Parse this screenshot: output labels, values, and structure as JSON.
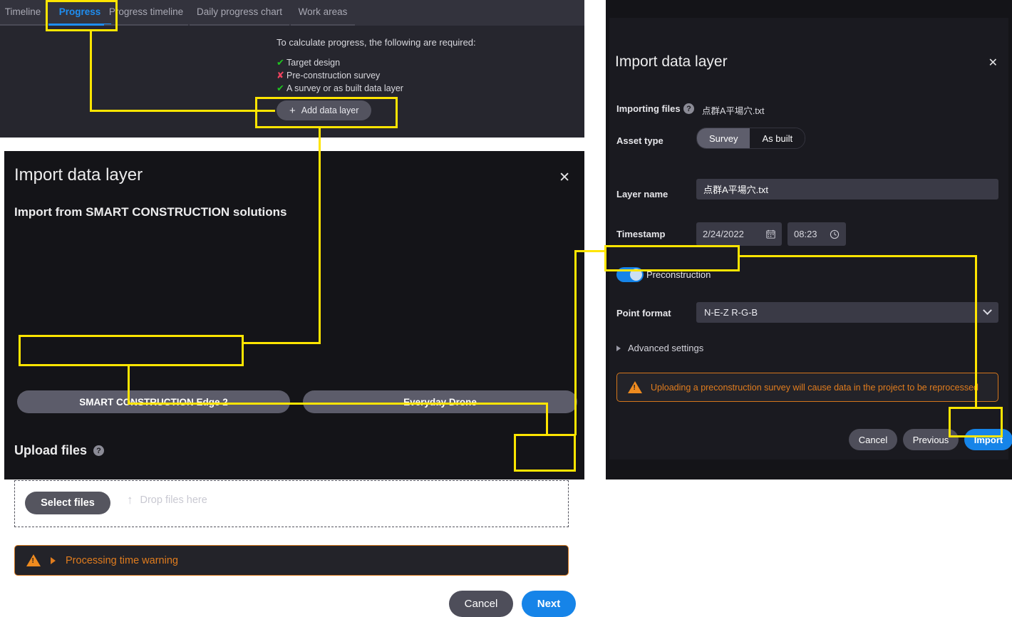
{
  "top_panel": {
    "tabs": [
      {
        "label": "Timeline",
        "active": false
      },
      {
        "label": "Progress",
        "active": true
      },
      {
        "label": "Progress timeline",
        "active": false
      },
      {
        "label": "Daily progress chart",
        "active": false
      },
      {
        "label": "Work areas",
        "active": false
      }
    ],
    "requirements_title": "To calculate progress, the following are required:",
    "requirements": [
      {
        "label": "Target design",
        "status": "ok",
        "mark": "✔"
      },
      {
        "label": "Pre-construction survey",
        "status": "missing",
        "mark": "✘"
      },
      {
        "label": "A survey or as built data layer",
        "status": "ok",
        "mark": "✔"
      }
    ],
    "add_data_layer_button": "Add data layer",
    "add_icon": "+"
  },
  "left_dialog": {
    "title": "Import data layer",
    "close_icon": "✕",
    "subtitle": "Import from SMART CONSTRUCTION solutions",
    "source_buttons": [
      {
        "label": "SMART CONSTRUCTION Edge 2"
      },
      {
        "label": "Everyday Drone"
      }
    ],
    "upload_heading": "Upload files",
    "upload_help_icon": "?",
    "select_files_button": "Select files",
    "drop_text": "Drop files here",
    "drop_icon": "↑",
    "warning_label": "Processing time warning",
    "warning_icon": "!",
    "cancel_button": "Cancel",
    "next_button": "Next"
  },
  "right_dialog": {
    "title": "Import data layer",
    "close_icon": "✕",
    "importing_files_label": "Importing files",
    "importing_files_help_icon": "?",
    "importing_files_value": "点群A平場穴.txt",
    "asset_type_label": "Asset type",
    "asset_type_options": [
      {
        "label": "Survey",
        "selected": true
      },
      {
        "label": "As built",
        "selected": false
      }
    ],
    "layer_name_label": "Layer name",
    "layer_name_value": "点群A平場穴.txt",
    "timestamp_label": "Timestamp",
    "timestamp_date": "2/24/2022",
    "timestamp_time": "08:23",
    "calendar_icon": "Ὄ5",
    "clock_icon": "◴",
    "preconstruction_label": "Preconstruction",
    "preconstruction_on": true,
    "point_format_label": "Point format",
    "point_format_value": "N-E-Z R-G-B",
    "advanced_settings_label": "Advanced settings",
    "warning_text": "Uploading a preconstruction survey will cause data in the project to be reprocessed",
    "warning_icon": "!",
    "cancel_button": "Cancel",
    "previous_button": "Previous",
    "import_button": "Import"
  },
  "annotation": {
    "highlight_color": "#ffe500",
    "highlighted_targets": [
      "tab-progress",
      "add-data-layer-button",
      "select-files-button",
      "next-button",
      "preconstruction-toggle",
      "import-button"
    ]
  }
}
